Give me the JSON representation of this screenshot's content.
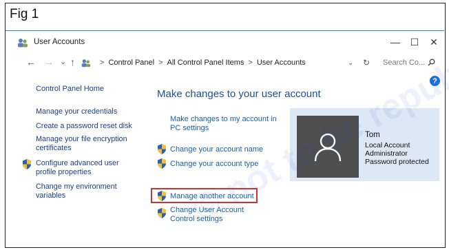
{
  "figure": {
    "label": "Fig 1"
  },
  "window": {
    "title": "User Accounts",
    "controls": {
      "minimize": "—",
      "maximize": "☐",
      "close": "✕"
    }
  },
  "address_bar": {
    "back": "←",
    "forward": "→",
    "recent": "⌄",
    "up": "↑",
    "crumbs": [
      "Control Panel",
      "All Control Panel Items",
      "User Accounts"
    ],
    "separator": ">",
    "dropdown": "⌄",
    "refresh": "↻",
    "search_placeholder": "Search Co...",
    "search_icon": "magnifier-icon"
  },
  "help": {
    "label": "?"
  },
  "left_pane": {
    "home": "Control Panel Home",
    "links": [
      {
        "label": "Manage your credentials"
      },
      {
        "label": "Create a password reset disk"
      },
      {
        "label": "Manage your file encryption certificates"
      },
      {
        "label": "Configure advanced user profile properties",
        "shield": true
      },
      {
        "label": "Change my environment variables"
      }
    ]
  },
  "main": {
    "heading": "Make changes to your user account",
    "links": [
      {
        "label": "Make changes to my account in PC settings",
        "shield": false
      },
      {
        "label": "Change your account name",
        "shield": true
      },
      {
        "label": "Change your account type",
        "shield": true
      },
      {
        "label": "Manage another account",
        "shield": true,
        "highlighted": true
      },
      {
        "label": "Change User Account Control settings",
        "shield": true
      }
    ]
  },
  "account": {
    "name": "Tom",
    "details": [
      "Local Account",
      "Administrator",
      "Password protected"
    ]
  },
  "watermark": {
    "text": "© not to be republished",
    "color": "#2850dc"
  },
  "colors": {
    "link": "#1a5fb0",
    "heading": "#1c4f9c",
    "highlight": "#d0312d",
    "card": "#dce8f6",
    "accent_rule": "#2a8fd8"
  }
}
